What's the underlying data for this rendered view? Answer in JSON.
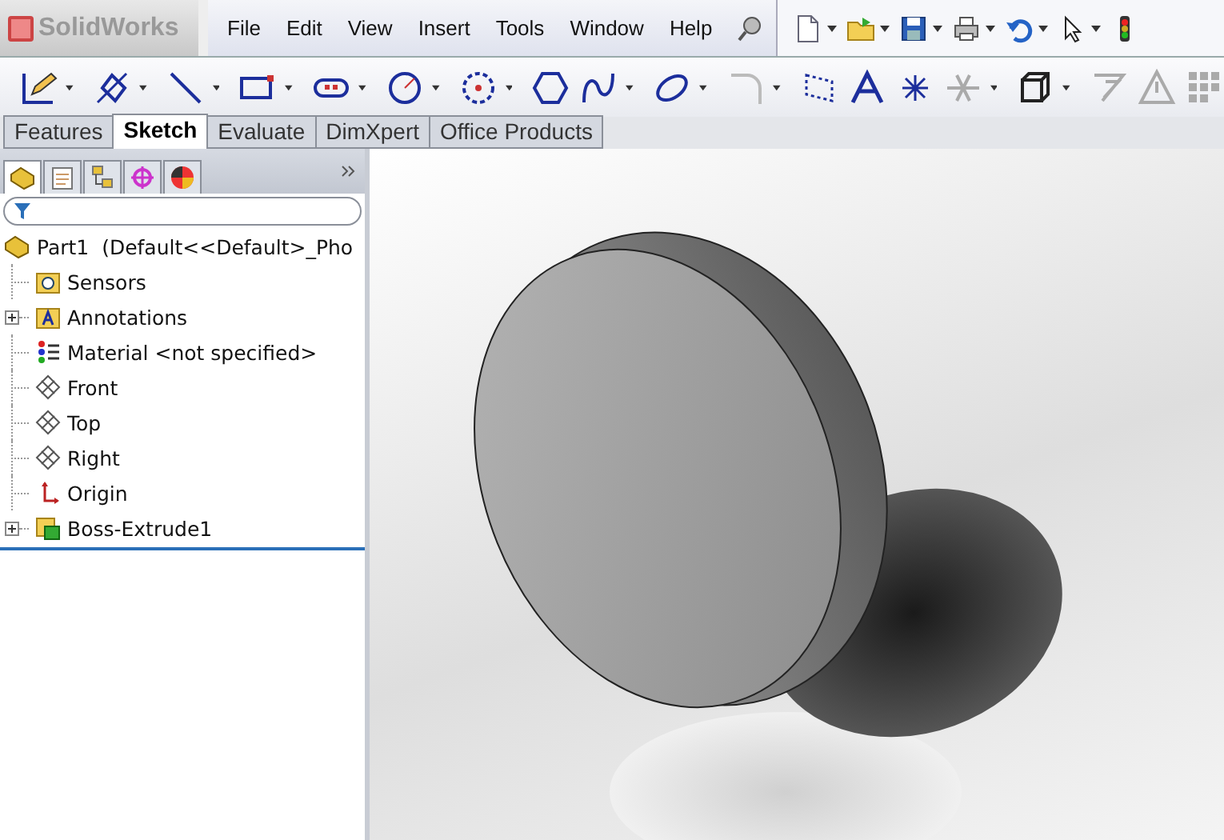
{
  "app": {
    "logo": "SolidWorks"
  },
  "menu": [
    "File",
    "Edit",
    "View",
    "Insert",
    "Tools",
    "Window",
    "Help"
  ],
  "command_tabs": [
    {
      "label": "Features",
      "selected": false
    },
    {
      "label": "Sketch",
      "selected": true
    },
    {
      "label": "Evaluate",
      "selected": false
    },
    {
      "label": "DimXpert",
      "selected": false
    },
    {
      "label": "Office Products",
      "selected": false
    }
  ],
  "panel_tabs": [
    {
      "selected": true
    },
    {
      "selected": false
    },
    {
      "selected": false
    },
    {
      "selected": false
    },
    {
      "selected": false
    }
  ],
  "feature_tree": {
    "root": {
      "label": "Part1  (Default<<Default>_Pho",
      "children": [
        {
          "label": "Sensors",
          "kind": "sensors",
          "expandable": false
        },
        {
          "label": "Annotations",
          "kind": "annotations",
          "expandable": true
        },
        {
          "label": "Material <not specified>",
          "kind": "material",
          "expandable": false
        },
        {
          "label": "Front",
          "kind": "plane",
          "expandable": false
        },
        {
          "label": "Top",
          "kind": "plane",
          "expandable": false
        },
        {
          "label": "Right",
          "kind": "plane",
          "expandable": false
        },
        {
          "label": "Origin",
          "kind": "origin",
          "expandable": false
        },
        {
          "label": "Boss-Extrude1",
          "kind": "feature",
          "expandable": true
        }
      ]
    }
  }
}
